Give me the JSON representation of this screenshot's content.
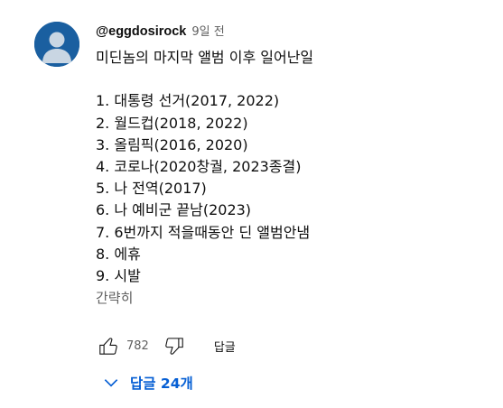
{
  "comment": {
    "author": "@eggdosirock",
    "time": "9일 전",
    "lines": [
      "미딘놈의 마지막 앨범 이후 일어난일",
      "",
      "1. 대통령 선거(2017, 2022)",
      "2. 월드컵(2018, 2022)",
      "3. 올림픽(2016, 2020)",
      "4. 코로나(2020창궐, 2023종결)",
      "5. 나 전역(2017)",
      "6. 나 예비군 끝남(2023)",
      "7. 6번까지 적을때동안 딘 앨범안냄",
      "8. 에휴",
      "9. 시발"
    ],
    "read_more": "간략히",
    "like_count": "782",
    "reply_label": "답글",
    "replies_label": "답글 24개"
  },
  "colors": {
    "avatar_bg": "#1a5fa0",
    "avatar_fg": "#c9d6e3",
    "link_blue": "#065fd4",
    "secondary_text": "#606060"
  },
  "icons": {
    "like": "thumbs-up-icon",
    "dislike": "thumbs-down-icon",
    "replies": "chevron-down-icon"
  }
}
